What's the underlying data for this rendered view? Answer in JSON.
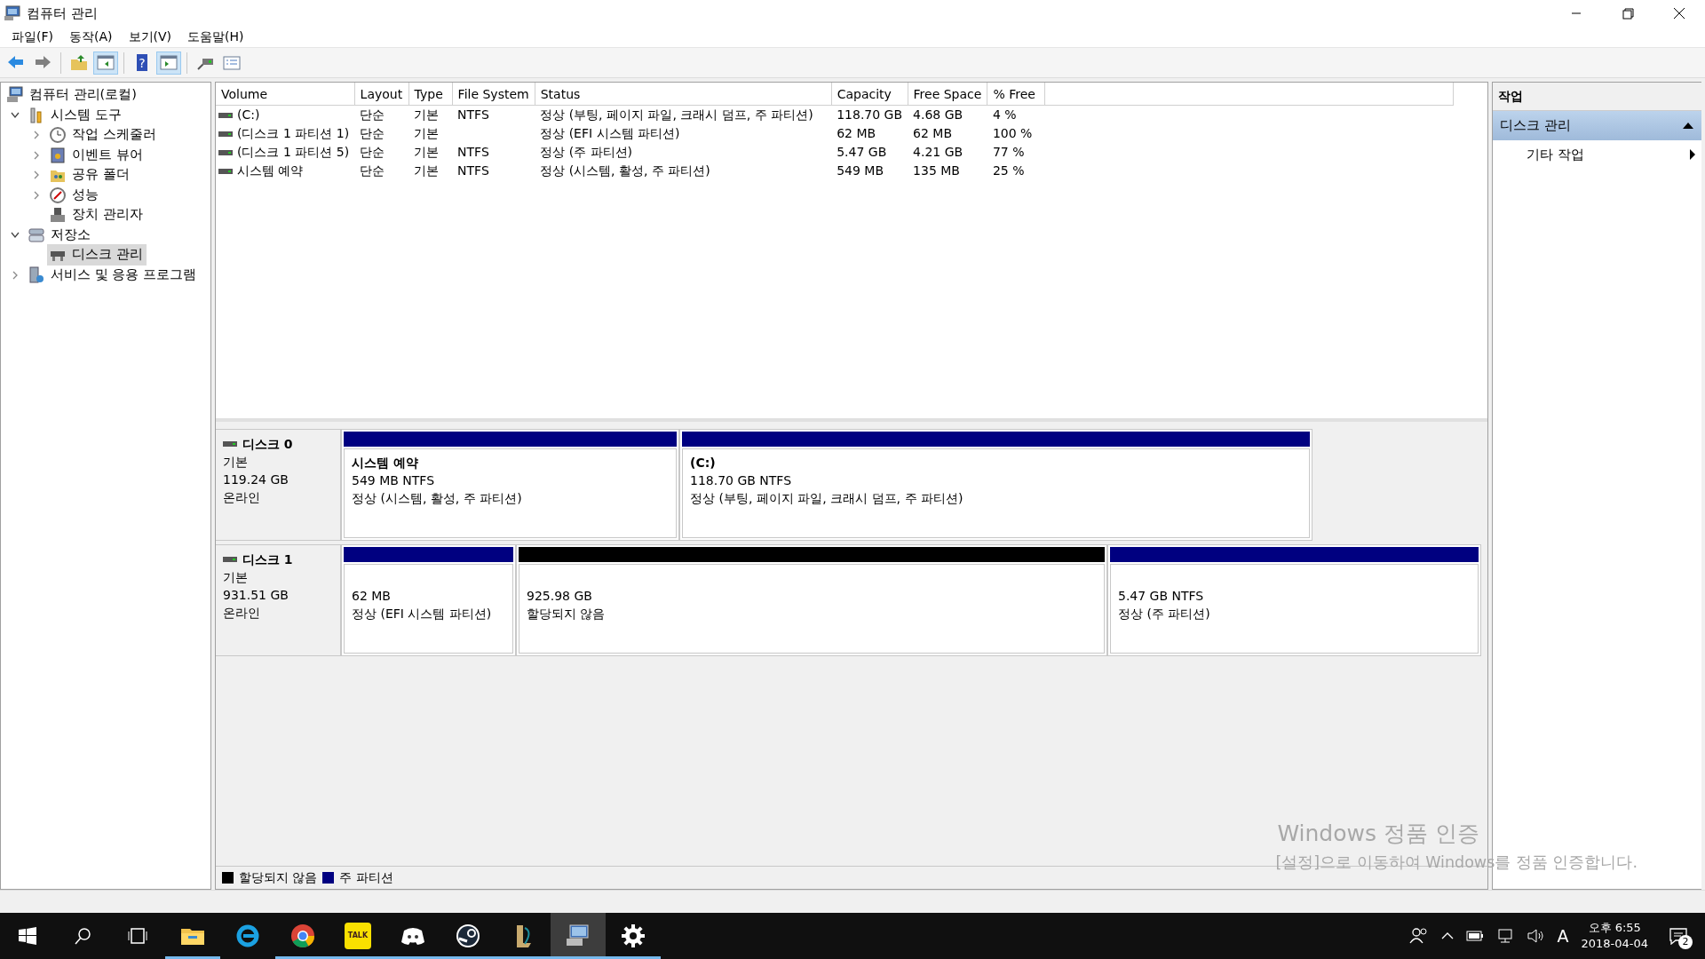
{
  "window": {
    "title": "컴퓨터 관리"
  },
  "menu": [
    {
      "label": "파일(F)"
    },
    {
      "label": "동작(A)"
    },
    {
      "label": "보기(V)"
    },
    {
      "label": "도움말(H)"
    }
  ],
  "toolbar": [
    {
      "kind": "back",
      "pressed": false
    },
    {
      "kind": "forward",
      "pressed": false
    },
    {
      "kind": "sep"
    },
    {
      "kind": "up",
      "pressed": false
    },
    {
      "kind": "tree",
      "pressed": true
    },
    {
      "kind": "sep"
    },
    {
      "kind": "help",
      "text": "?",
      "pressed": false
    },
    {
      "kind": "actions",
      "pressed": true
    },
    {
      "kind": "sep"
    },
    {
      "kind": "connect",
      "pressed": false
    },
    {
      "kind": "props",
      "pressed": false
    }
  ],
  "tree": [
    {
      "label": "컴퓨터 관리(로컬)",
      "kind": "computer",
      "selected": false,
      "children": [
        {
          "label": "시스템 도구",
          "kind": "tools",
          "expanded": true,
          "selected": false,
          "children": [
            {
              "label": "작업 스케줄러",
              "kind": "clock",
              "expanded": false,
              "selected": false
            },
            {
              "label": "이벤트 뷰어",
              "kind": "log",
              "expanded": false,
              "selected": false
            },
            {
              "label": "공유 폴더",
              "kind": "share",
              "expanded": false,
              "selected": false
            },
            {
              "label": "성능",
              "kind": "gauge",
              "expanded": false,
              "selected": false
            },
            {
              "label": "장치 관리자",
              "kind": "device",
              "selected": false
            }
          ]
        },
        {
          "label": "저장소",
          "kind": "storage",
          "expanded": true,
          "selected": false,
          "children": [
            {
              "label": "디스크 관리",
              "kind": "disk",
              "selected": true
            }
          ]
        },
        {
          "label": "서비스 및 응용 프로그램",
          "kind": "services",
          "expanded": false,
          "selected": false
        }
      ]
    }
  ],
  "volumes": {
    "columns": [
      "Volume",
      "Layout",
      "Type",
      "File System",
      "Status",
      "Capacity",
      "Free Space",
      "% Free"
    ],
    "rows": [
      [
        "(C:)",
        "단순",
        "기본",
        "NTFS",
        "정상 (부팅, 페이지 파일, 크래시 덤프, 주 파티션)",
        "118.70 GB",
        "4.68 GB",
        "4 %"
      ],
      [
        "(디스크 1 파티션 1)",
        "단순",
        "기본",
        "",
        "정상 (EFI 시스템 파티션)",
        "62 MB",
        "62 MB",
        "100 %"
      ],
      [
        "(디스크 1 파티션 5)",
        "단순",
        "기본",
        "NTFS",
        "정상 (주 파티션)",
        "5.47 GB",
        "4.21 GB",
        "77 %"
      ],
      [
        "시스템 예약",
        "단순",
        "기본",
        "NTFS",
        "정상 (시스템, 활성, 주 파티션)",
        "549 MB",
        "135 MB",
        "25 %"
      ]
    ]
  },
  "disks": [
    {
      "name": "디스크 0",
      "type": "기본",
      "size": "119.24 GB",
      "status": "온라인",
      "partitions": [
        {
          "kind": "primary",
          "name": "시스템 예약",
          "size": "549 MB NTFS",
          "status": "정상 (시스템, 활성, 주 파티션)"
        },
        {
          "kind": "primary",
          "name": "(C:)",
          "size": "118.70 GB NTFS",
          "status": "정상 (부팅, 페이지 파일, 크래시 덤프, 주 파티션)"
        }
      ]
    },
    {
      "name": "디스크 1",
      "type": "기본",
      "size": "931.51 GB",
      "status": "온라인",
      "partitions": [
        {
          "kind": "primary",
          "size": "62 MB",
          "status": "정상 (EFI 시스템 파티션)"
        },
        {
          "kind": "unallocated",
          "size": "925.98 GB",
          "status": "할당되지 않음"
        },
        {
          "kind": "primary",
          "size": "5.47 GB NTFS",
          "status": "정상 (주 파티션)"
        }
      ]
    }
  ],
  "legend": [
    {
      "label": "할당되지 않음",
      "color": "#000000"
    },
    {
      "label": "주 파티션",
      "color": "#000080"
    }
  ],
  "actions": {
    "title": "작업",
    "sections": [
      {
        "title": "디스크 관리",
        "expanded": true,
        "items": [
          {
            "label": "기타 작업",
            "submenu": true
          }
        ]
      }
    ]
  },
  "activation_notice": {
    "title": "Windows 정품 인증",
    "text": "[설정]으로 이동하여 Windows를 정품 인증합니다."
  },
  "taskbar": {
    "apps": [
      {
        "kind": "explorer",
        "running": true,
        "active": false
      },
      {
        "kind": "ie",
        "running": false,
        "active": false
      },
      {
        "kind": "chrome",
        "running": true,
        "active": false
      },
      {
        "kind": "kakao",
        "text": "TALK",
        "running": true,
        "active": false
      },
      {
        "kind": "discord",
        "running": true,
        "active": false
      },
      {
        "kind": "steam",
        "running": true,
        "active": false
      },
      {
        "kind": "lol",
        "running": true,
        "active": false
      },
      {
        "kind": "mmc",
        "running": true,
        "active": true
      },
      {
        "kind": "settings",
        "running": true,
        "active": false
      }
    ],
    "ime": "A",
    "time": "오후 6:55",
    "date": "2018-04-04",
    "notifications": "2"
  }
}
